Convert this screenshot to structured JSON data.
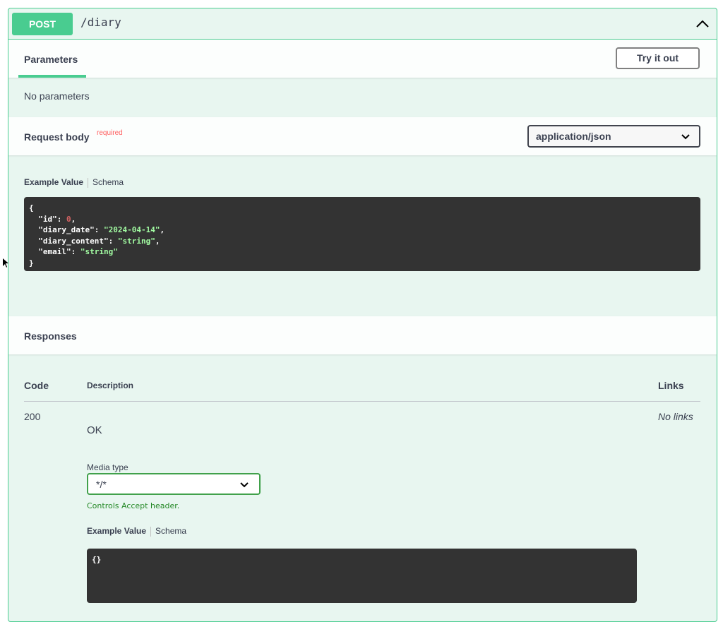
{
  "operation": {
    "method": "POST",
    "path": "/diary"
  },
  "parameters": {
    "title": "Parameters",
    "try_button": "Try it out",
    "empty_text": "No parameters"
  },
  "request_body": {
    "title": "Request body",
    "required": "required",
    "content_type": "application/json",
    "example_tab": "Example Value",
    "schema_tab": "Schema",
    "example": {
      "open": "{",
      "close": "}",
      "fields": [
        {
          "key": "\"id\"",
          "value": "0",
          "kind": "num",
          "comma": ","
        },
        {
          "key": "\"diary_date\"",
          "value": "\"2024-04-14\"",
          "kind": "str",
          "comma": ","
        },
        {
          "key": "\"diary_content\"",
          "value": "\"string\"",
          "kind": "str",
          "comma": ","
        },
        {
          "key": "\"email\"",
          "value": "\"string\"",
          "kind": "str",
          "comma": ""
        }
      ]
    }
  },
  "responses": {
    "title": "Responses",
    "col_code": "Code",
    "col_description": "Description",
    "col_links": "Links",
    "rows": [
      {
        "code": "200",
        "description": "OK",
        "links": "No links",
        "media_label": "Media type",
        "media_value": "*/*",
        "media_hint": "Controls Accept header.",
        "example_tab": "Example Value",
        "schema_tab": "Schema",
        "example": "{}"
      }
    ]
  },
  "colors": {
    "post": "#49cc90",
    "background": "#e8f6f0",
    "code_bg": "#333333",
    "string": "#a2fca2",
    "number": "#d36363",
    "required": "#ff6060",
    "hint": "#248826"
  }
}
